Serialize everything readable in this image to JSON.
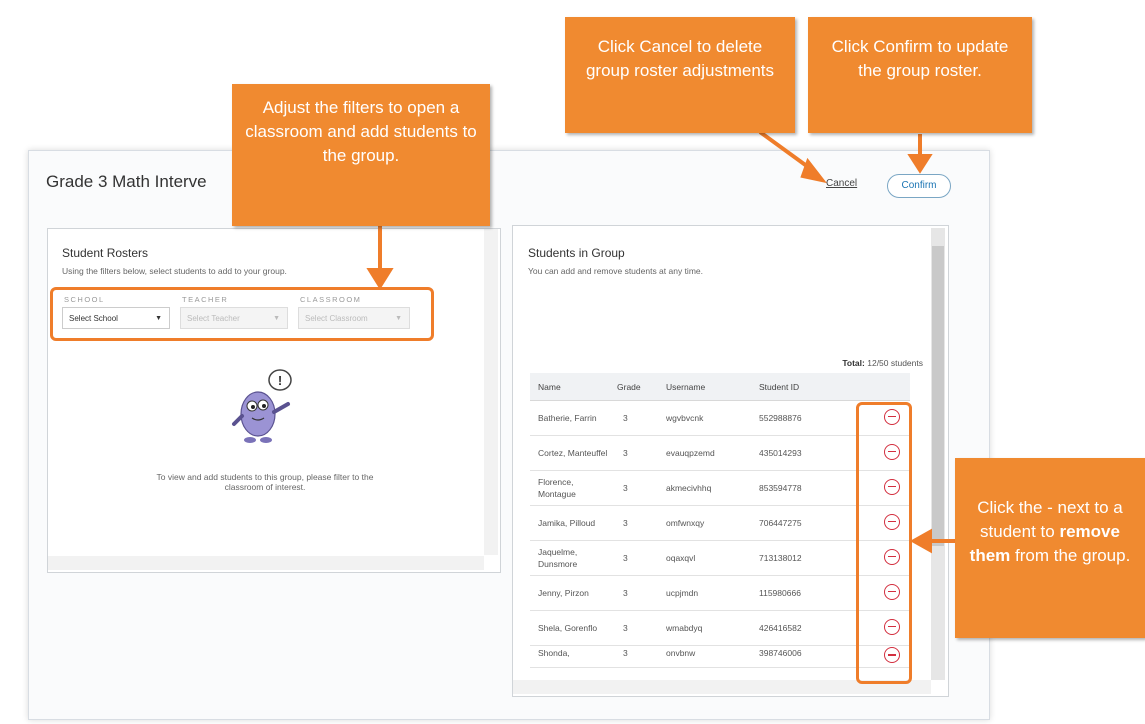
{
  "modal": {
    "title": "Grade 3 Math Interve",
    "cancel_label": "Cancel",
    "confirm_label": "Confirm"
  },
  "rosters": {
    "title": "Student Rosters",
    "subtitle": "Using the filters below, select students to add to your group.",
    "filters": {
      "school_label": "SCHOOL",
      "teacher_label": "TEACHER",
      "classroom_label": "CLASSROOM",
      "school_value": "Select School",
      "teacher_value": "Select Teacher",
      "classroom_value": "Select Classroom"
    },
    "empty_message": "To view and add students to this group, please filter to the classroom of interest."
  },
  "group": {
    "title": "Students in Group",
    "subtitle": "You can add and remove students at any time.",
    "total_label": "Total:",
    "total_value": "12/50 students",
    "columns": [
      "Name",
      "Grade",
      "Username",
      "Student ID"
    ],
    "rows": [
      {
        "name": "Batherie, Farrin",
        "grade": "3",
        "username": "wgvbvcnk",
        "id": "552988876"
      },
      {
        "name": "Cortez, Manteuffel",
        "grade": "3",
        "username": "evauqpzemd",
        "id": "435014293"
      },
      {
        "name": "Florence, Montague",
        "grade": "3",
        "username": "akmecivhhq",
        "id": "853594778"
      },
      {
        "name": "Jamika, Pilloud",
        "grade": "3",
        "username": "omfwnxqy",
        "id": "706447275"
      },
      {
        "name": "Jaquelme, Dunsmore",
        "grade": "3",
        "username": "oqaxqvl",
        "id": "713138012"
      },
      {
        "name": "Jenny, Pirzon",
        "grade": "3",
        "username": "ucpjmdn",
        "id": "115980666"
      },
      {
        "name": "Shela, Gorenflo",
        "grade": "3",
        "username": "wmabdyq",
        "id": "426416582"
      },
      {
        "name": "Shonda,",
        "grade": "3",
        "username": "onvbnw",
        "id": "398746006"
      }
    ]
  },
  "callouts": {
    "filters": "Adjust the filters to open a classroom and add students to the group.",
    "cancel": "Click Cancel to delete group roster adjustments",
    "confirm": "Click Confirm to update the group roster.",
    "remove_pre": "Click the - next to a student to",
    "remove_bold": "remove them",
    "remove_post": "from the group."
  },
  "colors": {
    "callout": "#f08a30",
    "highlight": "#ef7d2a",
    "remove": "#d32f3f",
    "confirm": "#1a74b3"
  }
}
